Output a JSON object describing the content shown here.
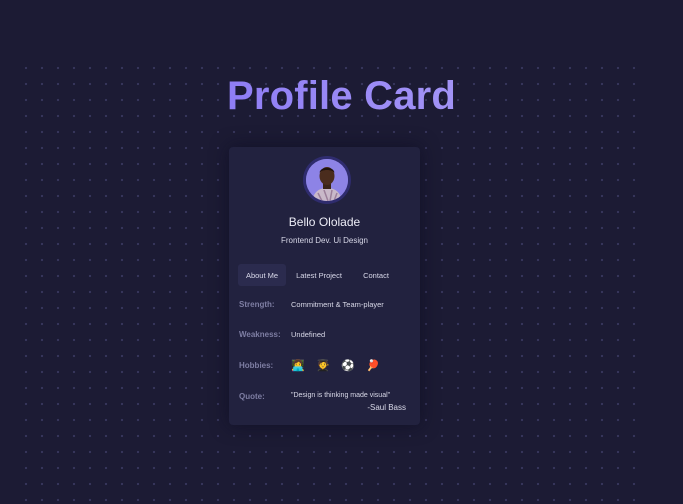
{
  "page": {
    "title": "Profile Card"
  },
  "profile": {
    "name": "Bello Ololade",
    "role": "Frontend Dev. Ui Design",
    "avatar_icon": "person-avatar"
  },
  "tabs": [
    {
      "label": "About Me",
      "active": true
    },
    {
      "label": "Latest Project",
      "active": false
    },
    {
      "label": "Contact",
      "active": false
    }
  ],
  "about": {
    "strength_label": "Strength:",
    "strength_value": "Commitment & Team-player",
    "weakness_label": "Weakness:",
    "weakness_value": "Undefined",
    "hobbies_label": "Hobbies:",
    "hobbies": [
      {
        "icon": "developer-emoji",
        "glyph": "👩‍💻"
      },
      {
        "icon": "student-emoji",
        "glyph": "🧑‍🎓"
      },
      {
        "icon": "soccer-ball-emoji",
        "glyph": "⚽"
      },
      {
        "icon": "ping-pong-emoji",
        "glyph": "🏓"
      }
    ],
    "quote_label": "Quote:",
    "quote_text": "\"Design is thinking made visual\"",
    "quote_author": "-Saul Bass"
  },
  "colors": {
    "background": "#1c1b34",
    "card": "#22223f",
    "accent": "#7a67f2",
    "label": "#7e7ea3"
  }
}
